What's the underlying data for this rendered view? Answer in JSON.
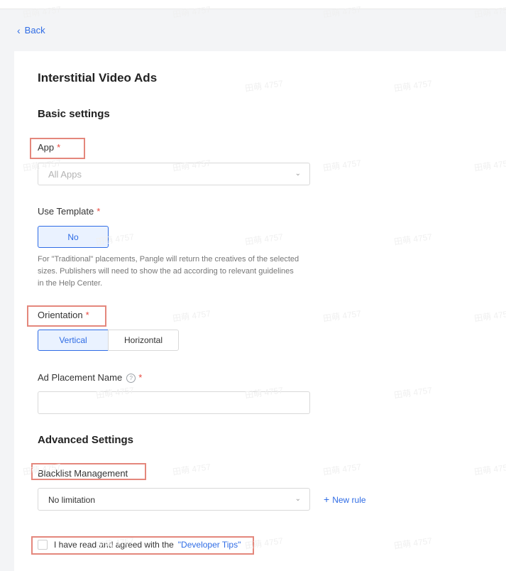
{
  "back_label": "Back",
  "page_title": "Interstitial Video Ads",
  "sections": {
    "basic": "Basic settings",
    "advanced": "Advanced Settings"
  },
  "app_field": {
    "label": "App",
    "required": "*",
    "placeholder": "All Apps"
  },
  "template_field": {
    "label": "Use Template",
    "required": "*",
    "option": "No",
    "description": "For \"Traditional\" placements, Pangle will return the creatives of the selected sizes. Publishers will need to show the ad according to relevant guidelines in the Help Center."
  },
  "orientation_field": {
    "label": "Orientation",
    "required": "*",
    "options": [
      "Vertical",
      "Horizontal"
    ],
    "selected": "Vertical"
  },
  "placement_field": {
    "label": "Ad Placement Name",
    "help_glyph": "?",
    "required": "*",
    "value": ""
  },
  "blacklist_field": {
    "label": "Blacklist Management",
    "value": "No limitation",
    "new_rule": "New rule",
    "plus": "+"
  },
  "agreement": {
    "text": "I have read and agreed with the",
    "link": "\"Developer Tips\""
  },
  "watermark": "田萌 4757",
  "colors": {
    "accent": "#2f6ce5",
    "required": "#e8483e",
    "highlight": "#e4877c"
  }
}
